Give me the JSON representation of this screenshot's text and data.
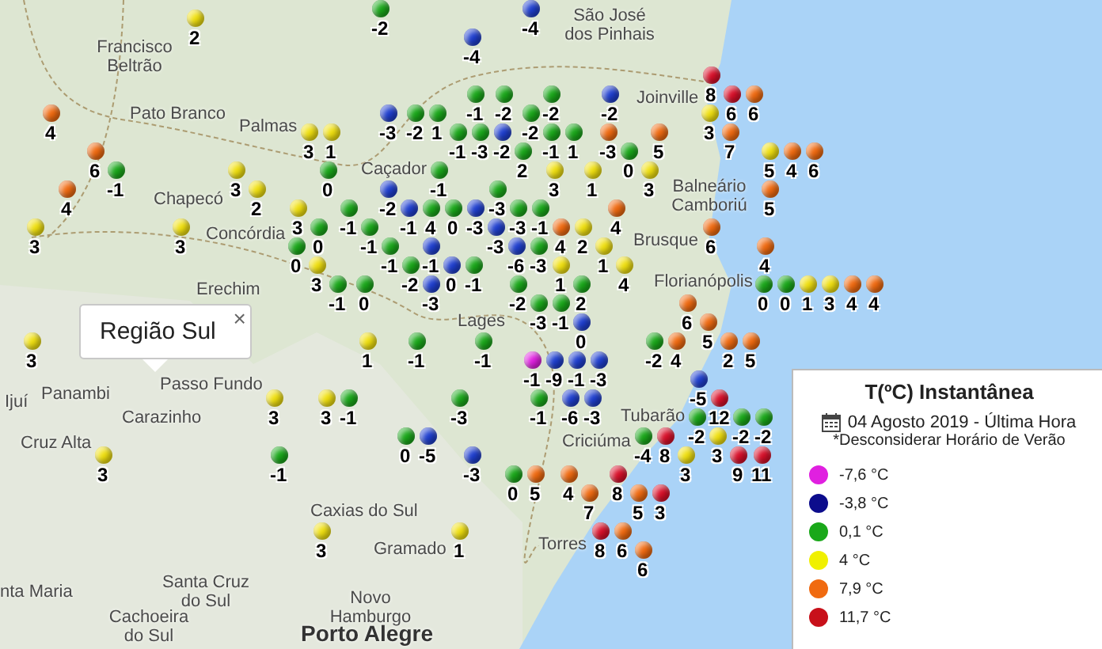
{
  "places": [
    {
      "name": "São José dos Pinhais"
    },
    {
      "name": "Francisco Beltrão"
    },
    {
      "name": "Pato Branco"
    },
    {
      "name": "Palmas"
    },
    {
      "name": "Chapecó"
    },
    {
      "name": "Concórdia"
    },
    {
      "name": "Erechim"
    },
    {
      "name": "Panambi"
    },
    {
      "name": "Ijuí"
    },
    {
      "name": "Passo Fundo"
    },
    {
      "name": "Carazinho"
    },
    {
      "name": "Cruz Alta"
    },
    {
      "name": "Caçador"
    },
    {
      "name": "Lages"
    },
    {
      "name": "Caxias do Sul"
    },
    {
      "name": "Gramado"
    },
    {
      "name": "Novo Hamburgo"
    },
    {
      "name": "Porto Alegre"
    },
    {
      "name": "nta Maria"
    },
    {
      "name": "Santa Cruz do Sul"
    },
    {
      "name": "Cachoeira do Sul"
    },
    {
      "name": "Joinville"
    },
    {
      "name": "Balneário Camboriú"
    },
    {
      "name": "Brusque"
    },
    {
      "name": "Florianópolis"
    },
    {
      "name": "Tubarão"
    },
    {
      "name": "Criciúma"
    },
    {
      "name": "Torres"
    }
  ],
  "stations": [
    {
      "value": "-2",
      "color": "#1aa81a"
    },
    {
      "value": "-4",
      "color": "#1f3fcf"
    },
    {
      "value": "2",
      "color": "#f0e010"
    },
    {
      "value": "-4",
      "color": "#1f3fcf"
    },
    {
      "value": "8",
      "color": "#d9102a"
    },
    {
      "value": "-1",
      "color": "#1aa81a"
    },
    {
      "value": "-2",
      "color": "#1aa81a"
    },
    {
      "value": "-2",
      "color": "#1aa81a"
    },
    {
      "value": "-2",
      "color": "#1f3fcf"
    },
    {
      "value": "6",
      "color": "#d9102a"
    },
    {
      "value": "6",
      "color": "#f06a10"
    },
    {
      "value": "4",
      "color": "#f06a10"
    },
    {
      "value": "-3",
      "color": "#1f3fcf"
    },
    {
      "value": "-2",
      "color": "#1aa81a"
    },
    {
      "value": "1",
      "color": "#1aa81a"
    },
    {
      "value": "-2",
      "color": "#1aa81a"
    },
    {
      "value": "3",
      "color": "#f0e010"
    },
    {
      "value": "3",
      "color": "#f0e010"
    },
    {
      "value": "1",
      "color": "#f0e010"
    },
    {
      "value": "-1",
      "color": "#1aa81a"
    },
    {
      "value": "-3",
      "color": "#1aa81a"
    },
    {
      "value": "-2",
      "color": "#1f3fcf"
    },
    {
      "value": "-1",
      "color": "#1aa81a"
    },
    {
      "value": "1",
      "color": "#1aa81a"
    },
    {
      "value": "-3",
      "color": "#f06a10"
    },
    {
      "value": "5",
      "color": "#f06a10"
    },
    {
      "value": "7",
      "color": "#f06a10"
    },
    {
      "value": "6",
      "color": "#f06a10"
    },
    {
      "value": "2",
      "color": "#1aa81a"
    },
    {
      "value": "0",
      "color": "#1aa81a"
    },
    {
      "value": "5",
      "color": "#f0e010"
    },
    {
      "value": "4",
      "color": "#f06a10"
    },
    {
      "value": "6",
      "color": "#f06a10"
    },
    {
      "value": "-1",
      "color": "#1aa81a"
    },
    {
      "value": "3",
      "color": "#f0e010"
    },
    {
      "value": "0",
      "color": "#1aa81a"
    },
    {
      "value": "-1",
      "color": "#1aa81a"
    },
    {
      "value": "3",
      "color": "#f0e010"
    },
    {
      "value": "1",
      "color": "#f0e010"
    },
    {
      "value": "3",
      "color": "#f0e010"
    },
    {
      "value": "4",
      "color": "#f06a10"
    },
    {
      "value": "2",
      "color": "#f0e010"
    },
    {
      "value": "-2",
      "color": "#1f3fcf"
    },
    {
      "value": "-3",
      "color": "#1aa81a"
    },
    {
      "value": "5",
      "color": "#f06a10"
    },
    {
      "value": "3",
      "color": "#f0e010"
    },
    {
      "value": "-1",
      "color": "#1aa81a"
    },
    {
      "value": "-1",
      "color": "#1f3fcf"
    },
    {
      "value": "4",
      "color": "#1aa81a"
    },
    {
      "value": "0",
      "color": "#1aa81a"
    },
    {
      "value": "-3",
      "color": "#1f3fcf"
    },
    {
      "value": "-3",
      "color": "#1aa81a"
    },
    {
      "value": "-1",
      "color": "#1aa81a"
    },
    {
      "value": "4",
      "color": "#f06a10"
    },
    {
      "value": "3",
      "color": "#f0e010"
    },
    {
      "value": "3",
      "color": "#f0e010"
    },
    {
      "value": "0",
      "color": "#1aa81a"
    },
    {
      "value": "-1",
      "color": "#1aa81a"
    },
    {
      "value": "-3",
      "color": "#1f3fcf"
    },
    {
      "value": "4",
      "color": "#f06a10"
    },
    {
      "value": "2",
      "color": "#f0e010"
    },
    {
      "value": "6",
      "color": "#f06a10"
    },
    {
      "value": "0",
      "color": "#1aa81a"
    },
    {
      "value": "-1",
      "color": "#1aa81a"
    },
    {
      "value": "-1",
      "color": "#1f3fcf"
    },
    {
      "value": "-6",
      "color": "#1f3fcf"
    },
    {
      "value": "-3",
      "color": "#1aa81a"
    },
    {
      "value": "1",
      "color": "#f0e010"
    },
    {
      "value": "4",
      "color": "#f06a10"
    },
    {
      "value": "3",
      "color": "#f0e010"
    },
    {
      "value": "-2",
      "color": "#1aa81a"
    },
    {
      "value": "0",
      "color": "#1f3fcf"
    },
    {
      "value": "-1",
      "color": "#1aa81a"
    },
    {
      "value": "1",
      "color": "#f0e010"
    },
    {
      "value": "4",
      "color": "#f0e010"
    },
    {
      "value": "-1",
      "color": "#1aa81a"
    },
    {
      "value": "0",
      "color": "#1aa81a"
    },
    {
      "value": "-3",
      "color": "#1f3fcf"
    },
    {
      "value": "-2",
      "color": "#1aa81a"
    },
    {
      "value": "2",
      "color": "#1aa81a"
    },
    {
      "value": "0",
      "color": "#1aa81a"
    },
    {
      "value": "0",
      "color": "#1aa81a"
    },
    {
      "value": "1",
      "color": "#f0e010"
    },
    {
      "value": "3",
      "color": "#f0e010"
    },
    {
      "value": "4",
      "color": "#f06a10"
    },
    {
      "value": "4",
      "color": "#f06a10"
    },
    {
      "value": "-3",
      "color": "#1aa81a"
    },
    {
      "value": "-1",
      "color": "#1aa81a"
    },
    {
      "value": "6",
      "color": "#f06a10"
    },
    {
      "value": "0",
      "color": "#1f3fcf"
    },
    {
      "value": "5",
      "color": "#f06a10"
    },
    {
      "value": "3",
      "color": "#f0e010"
    },
    {
      "value": "1",
      "color": "#f0e010"
    },
    {
      "value": "-1",
      "color": "#1aa81a"
    },
    {
      "value": "-1",
      "color": "#1aa81a"
    },
    {
      "value": "-2",
      "color": "#1aa81a"
    },
    {
      "value": "4",
      "color": "#f06a10"
    },
    {
      "value": "2",
      "color": "#f06a10"
    },
    {
      "value": "5",
      "color": "#f06a10"
    },
    {
      "value": "-1",
      "color": "#e020e0"
    },
    {
      "value": "-9",
      "color": "#1f3fcf"
    },
    {
      "value": "-1",
      "color": "#1f3fcf"
    },
    {
      "value": "-3",
      "color": "#1f3fcf"
    },
    {
      "value": "-5",
      "color": "#1f3fcf"
    },
    {
      "value": "3",
      "color": "#f0e010"
    },
    {
      "value": "3",
      "color": "#f0e010"
    },
    {
      "value": "-1",
      "color": "#1aa81a"
    },
    {
      "value": "-3",
      "color": "#1aa81a"
    },
    {
      "value": "-1",
      "color": "#1aa81a"
    },
    {
      "value": "-6",
      "color": "#1f3fcf"
    },
    {
      "value": "-3",
      "color": "#1f3fcf"
    },
    {
      "value": "12",
      "color": "#d9102a"
    },
    {
      "value": "-2",
      "color": "#1aa81a"
    },
    {
      "value": "-2",
      "color": "#1aa81a"
    },
    {
      "value": "-2",
      "color": "#1aa81a"
    },
    {
      "value": "0",
      "color": "#1aa81a"
    },
    {
      "value": "-5",
      "color": "#1f3fcf"
    },
    {
      "value": "-4",
      "color": "#1aa81a"
    },
    {
      "value": "8",
      "color": "#d9102a"
    },
    {
      "value": "3",
      "color": "#f0e010"
    },
    {
      "value": "3",
      "color": "#f0e010"
    },
    {
      "value": "-1",
      "color": "#1aa81a"
    },
    {
      "value": "-3",
      "color": "#1f3fcf"
    },
    {
      "value": "3",
      "color": "#f0e010"
    },
    {
      "value": "9",
      "color": "#d9102a"
    },
    {
      "value": "11",
      "color": "#d9102a"
    },
    {
      "value": "0",
      "color": "#1aa81a"
    },
    {
      "value": "5",
      "color": "#f06a10"
    },
    {
      "value": "4",
      "color": "#f06a10"
    },
    {
      "value": "8",
      "color": "#d9102a"
    },
    {
      "value": "7",
      "color": "#f06a10"
    },
    {
      "value": "5",
      "color": "#f06a10"
    },
    {
      "value": "3",
      "color": "#d9102a"
    },
    {
      "value": "3",
      "color": "#f0e010"
    },
    {
      "value": "1",
      "color": "#f0e010"
    },
    {
      "value": "8",
      "color": "#d9102a"
    },
    {
      "value": "6",
      "color": "#f06a10"
    },
    {
      "value": "6",
      "color": "#f06a10"
    }
  ],
  "popup": {
    "title": "Região Sul",
    "close": "×"
  },
  "legend": {
    "title": "T(ºC) Instantânea",
    "date": "04 Agosto 2019 - Última Hora",
    "note": "*Desconsiderar Horário de Verão",
    "items": [
      {
        "label": "-7,6 °C",
        "color": "#e020e0"
      },
      {
        "label": "-3,8 °C",
        "color": "#0c0c8c"
      },
      {
        "label": "0,1 °C",
        "color": "#1aa81a"
      },
      {
        "label": "4 °C",
        "color": "#f0f000"
      },
      {
        "label": "7,9 °C",
        "color": "#f06a10"
      },
      {
        "label": "11,7 °C",
        "color": "#c8101a"
      }
    ]
  }
}
